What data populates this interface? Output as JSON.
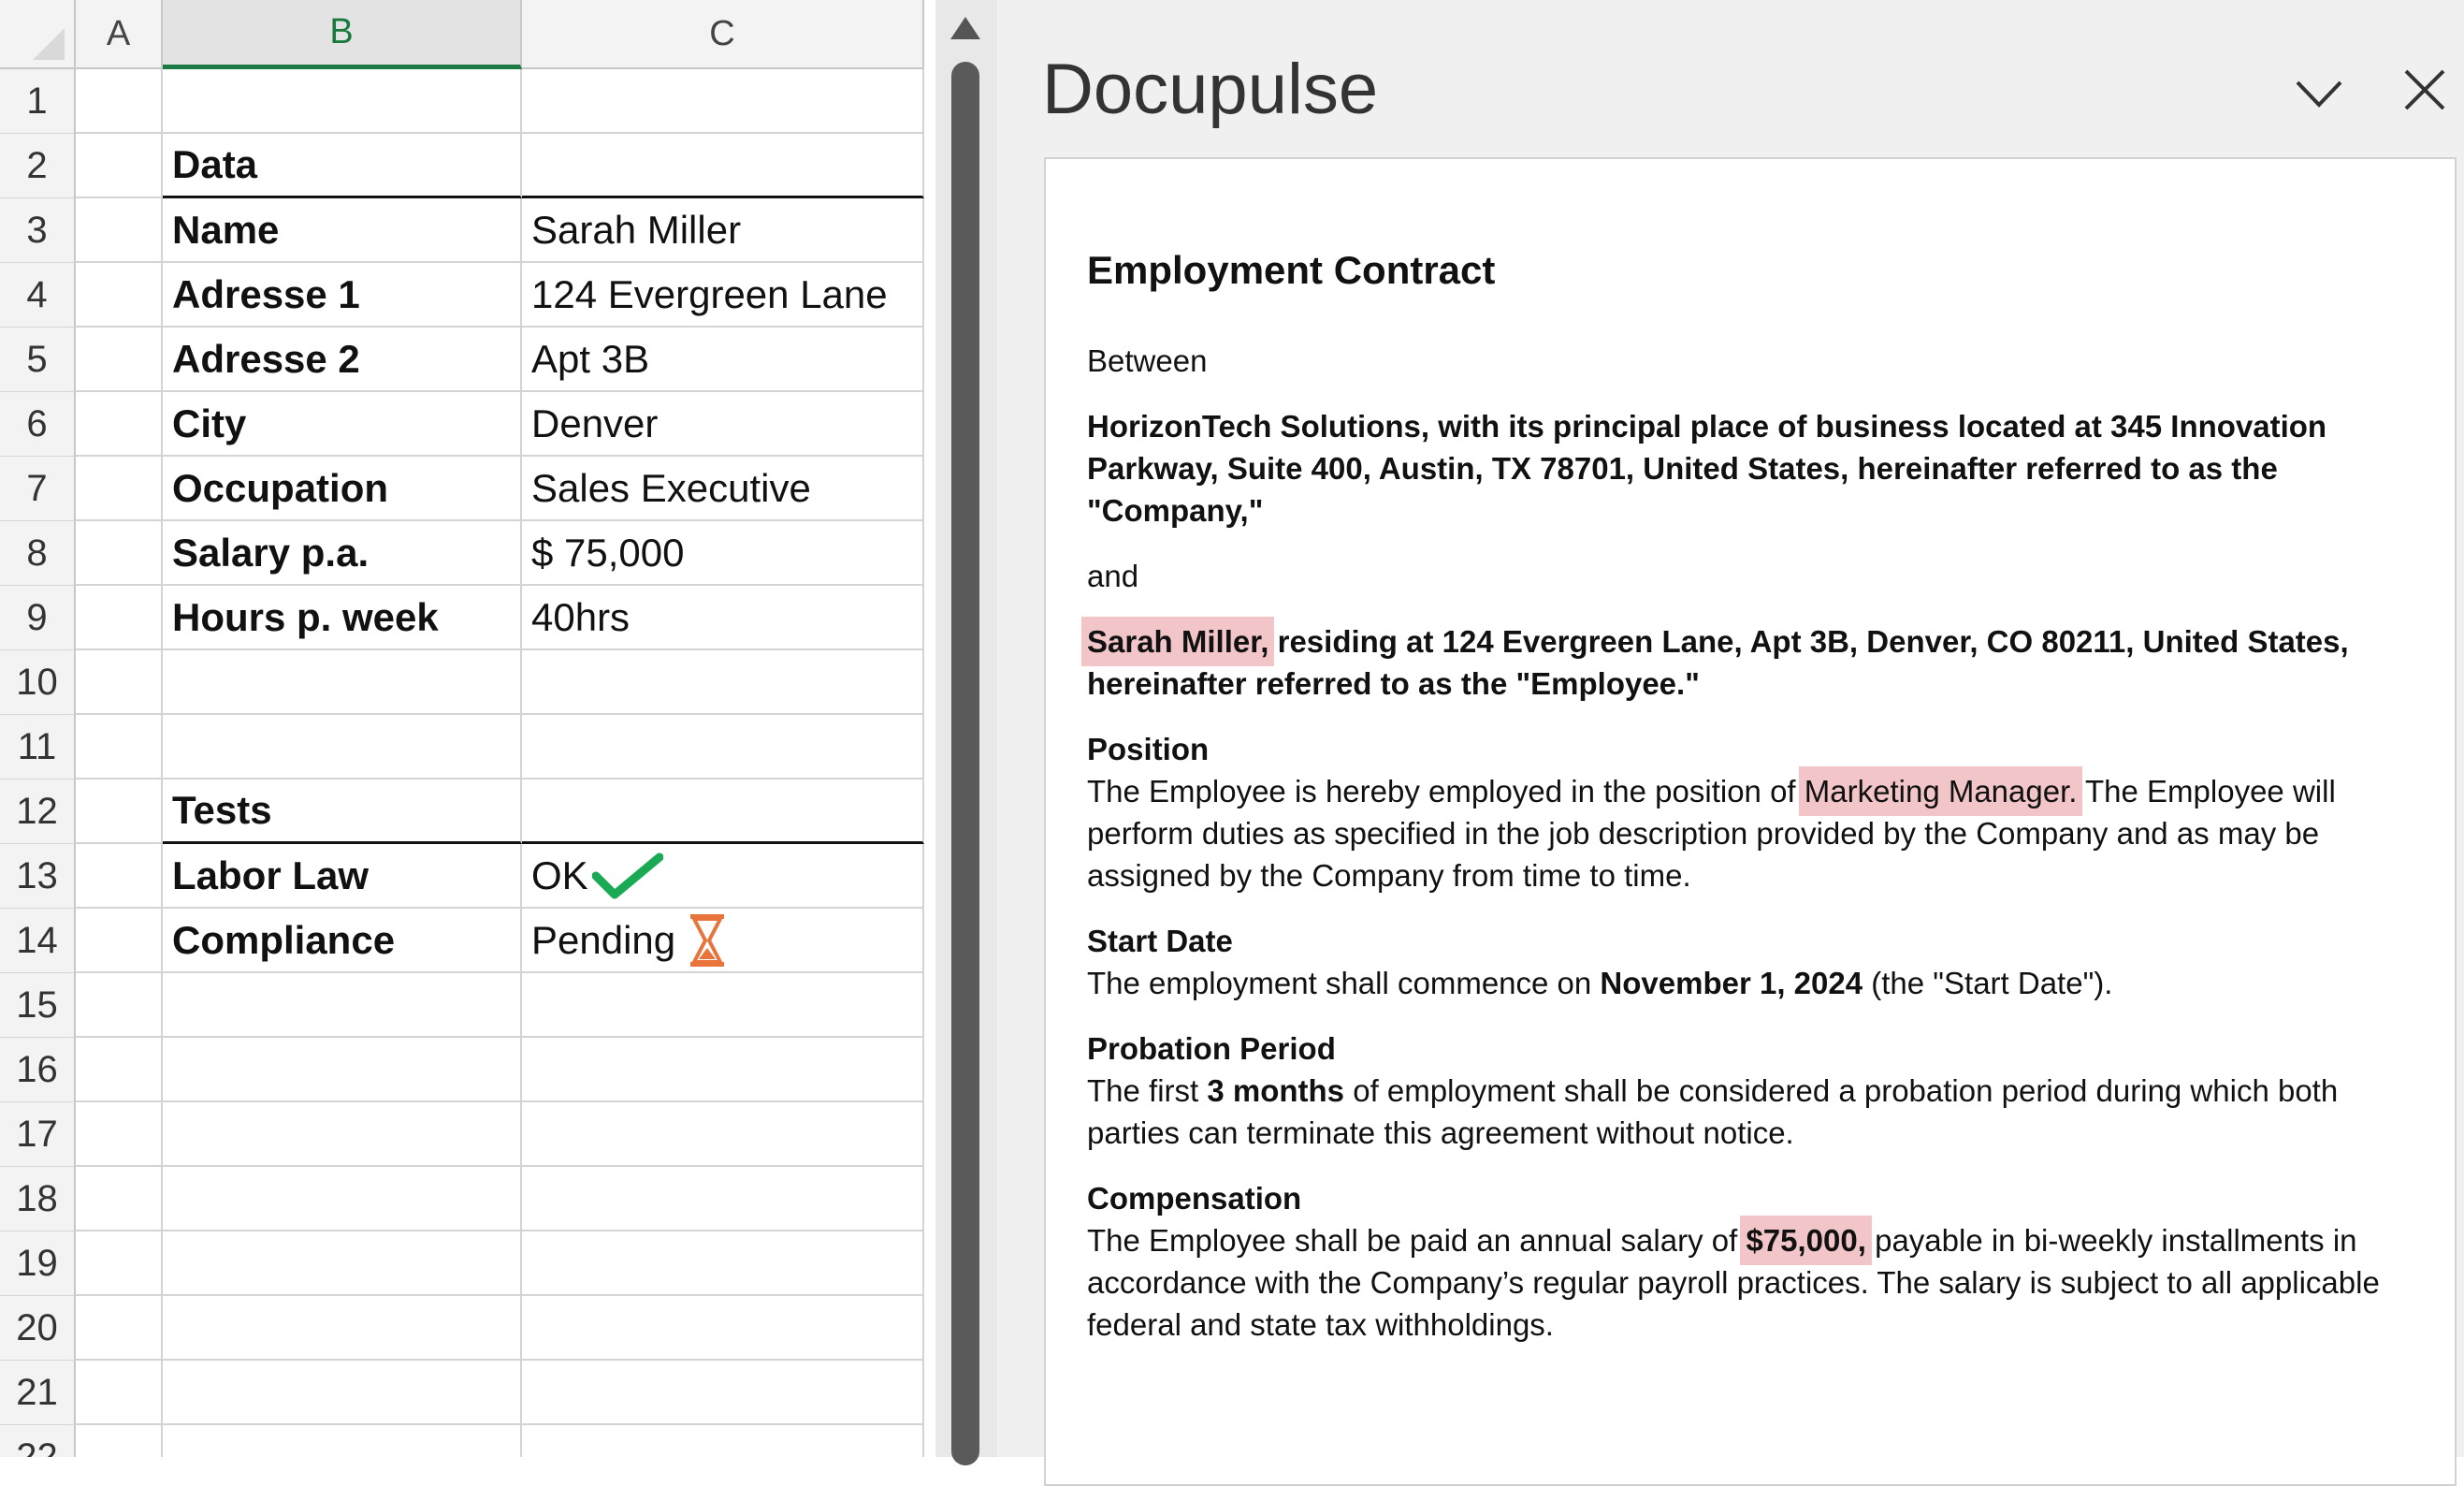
{
  "spreadsheet": {
    "columns": [
      "A",
      "B",
      "C"
    ],
    "selected_column": "B",
    "row_numbers": [
      "1",
      "2",
      "3",
      "4",
      "5",
      "6",
      "7",
      "8",
      "9",
      "10",
      "11",
      "12",
      "13",
      "14",
      "15",
      "16",
      "17",
      "18",
      "19",
      "20",
      "21",
      "22"
    ],
    "data_header": "Data",
    "fields": [
      {
        "label": "Name",
        "value": "Sarah Miller"
      },
      {
        "label": "Adresse 1",
        "value": "124 Evergreen Lane"
      },
      {
        "label": "Adresse 2",
        "value": "Apt 3B"
      },
      {
        "label": "City",
        "value": "Denver"
      },
      {
        "label": "Occupation",
        "value": "Sales Executive"
      },
      {
        "label": "Salary p.a.",
        "value": "$ 75,000"
      },
      {
        "label": "Hours p. week",
        "value": "40hrs"
      }
    ],
    "tests_header": "Tests",
    "tests": [
      {
        "label": "Labor Law",
        "value": "OK",
        "icon": "checkmark-icon",
        "color": "#1aaa55"
      },
      {
        "label": "Compliance",
        "value": "Pending",
        "icon": "hourglass-icon",
        "color": "#e8743b"
      }
    ]
  },
  "pane": {
    "title": "Docupulse",
    "chevron_icon": "chevron-down-icon",
    "close_icon": "close-icon",
    "highlight_color": "#f2c5c9"
  },
  "document": {
    "title": "Employment Contract",
    "between": "Between",
    "company": "HorizonTech Solutions, with its principal place of business located at 345 Innovation Parkway, Suite 400, Austin, TX 78701, United States, hereinafter referred to as the \"Company,\"",
    "and": "and",
    "employee_name": "Sarah Miller,",
    "employee_rest": " residing at 124 Evergreen Lane, Apt 3B, Denver, CO 80211, United States, hereinafter referred to as the \"Employee.\"",
    "position": {
      "heading": "Position",
      "before": "The Employee is hereby employed in the position of ",
      "highlight": "Marketing Manager.",
      "after": " The Employee will perform duties as specified in the job description provided by the Company and as may be assigned by the Company from time to time."
    },
    "start_date": {
      "heading": "Start Date",
      "before": "The employment shall commence on ",
      "bold": "November 1, 2024",
      "after": " (the \"Start Date\")."
    },
    "probation": {
      "heading": "Probation Period",
      "before": "The first ",
      "bold": "3 months",
      "after": " of employment shall be considered a probation period during which both parties can terminate this agreement without notice."
    },
    "compensation": {
      "heading": "Compensation",
      "before": "The Employee shall be paid an annual salary of ",
      "highlight": "$75,000,",
      "after": " payable in bi-weekly installments in accordance with the Company’s regular payroll practices. The salary is subject to all applicable federal and state tax withholdings."
    }
  }
}
